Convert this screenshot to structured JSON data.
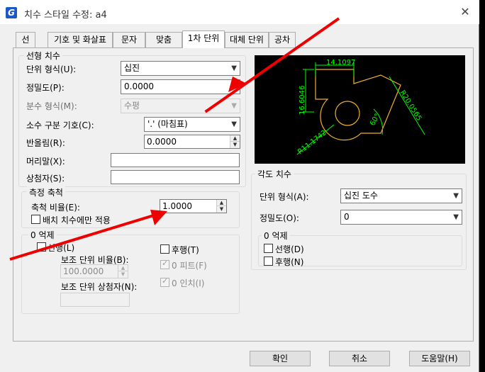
{
  "window": {
    "title": "치수 스타일 수정: a4",
    "logo": "G",
    "close": "✕"
  },
  "tabs": [
    "선",
    "기호 및 화살표",
    "문자",
    "맞춤",
    "1차 단위",
    "대체 단위",
    "공차"
  ],
  "linear": {
    "group_title": "선형 치수",
    "unit_format_label": "단위 형식(U):",
    "unit_format_value": "십진",
    "precision_label": "정밀도(P):",
    "precision_value": "0.0000",
    "fraction_label": "분수 형식(M):",
    "fraction_value": "수평",
    "decimal_sep_label": "소수 구분 기호(C):",
    "decimal_sep_value": "'.' (마침표)",
    "round_label": "반올림(R):",
    "round_value": "0.0000",
    "prefix_label": "머리말(X):",
    "prefix_value": "",
    "suffix_label": "상첨자(S):",
    "suffix_value": ""
  },
  "scale": {
    "group_title": "측정 축척",
    "factor_label": "축척 비율(E):",
    "factor_value": "1.0000",
    "layout_only_label": "배치 치수에만 적용"
  },
  "zero_left": {
    "group_title": "0 억제",
    "leading_label": "선행(L)",
    "trailing_label": "후행(T)",
    "sub_factor_label": "보조 단위 비율(B):",
    "sub_factor_value": "100.0000",
    "feet_label": "0 피트(F)",
    "sub_suffix_label": "보조 단위 상첨자(N):",
    "inches_label": "0 인치(I)"
  },
  "angular": {
    "group_title": "각도 치수",
    "unit_format_label": "단위 형식(A):",
    "unit_format_value": "십진 도수",
    "precision_label": "정밀도(O):",
    "precision_value": "0",
    "zero_title": "0 억제",
    "leading_label": "선행(D)",
    "trailing_label": "후행(N)"
  },
  "preview": {
    "dim_top": "14.1097",
    "dim_left": "16.6046",
    "dim_diag": "R20.0565",
    "dim_radius": "R11.1742",
    "dim_angle": "60°"
  },
  "buttons": {
    "ok": "확인",
    "cancel": "취소",
    "help": "도움말(H)"
  },
  "colors": {
    "annotation_arrow": "#e00000",
    "preview_dim": "#00ff00",
    "preview_geom": "#f0b030"
  }
}
